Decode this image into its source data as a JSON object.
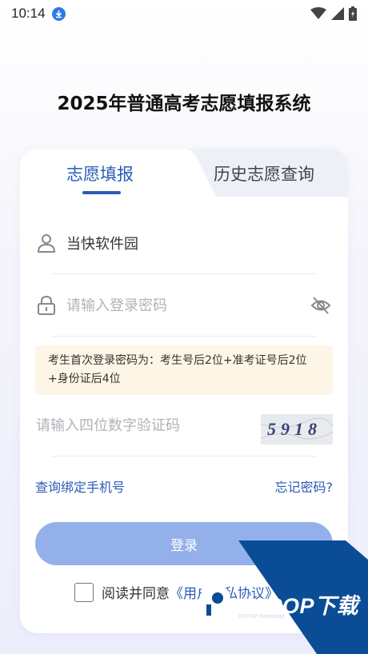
{
  "status_bar": {
    "time": "10:14",
    "icons": [
      "download-icon",
      "wifi-icon",
      "signal-icon",
      "battery-icon"
    ]
  },
  "page": {
    "title": "2025年普通高考志愿填报系统"
  },
  "tabs": [
    {
      "label": "志愿填报",
      "active": true
    },
    {
      "label": "历史志愿查询",
      "active": false
    }
  ],
  "form": {
    "username": {
      "value": "当快软件园",
      "placeholder": ""
    },
    "password": {
      "value": "",
      "placeholder": "请输入登录密码"
    },
    "hint": "考生首次登录密码为：考生号后2位+准考证号后2位+身份证后4位",
    "captcha": {
      "value": "",
      "placeholder": "请输入四位数字验证码",
      "image_text": "5918"
    },
    "links": {
      "bind_phone": "查询绑定手机号",
      "forgot_password": "忘记密码?"
    },
    "login_label": "登录",
    "agreement": {
      "text": "阅读并同意",
      "link": "《用户隐私协议》"
    }
  },
  "watermark": {
    "brand": "PCPOP下载",
    "sub": "PCPOP Download"
  },
  "colors": {
    "accent": "#2a5bb8",
    "login_button": "#94b0ea",
    "hint_bg": "#fdf6e6",
    "watermark": "#0a4d96"
  }
}
